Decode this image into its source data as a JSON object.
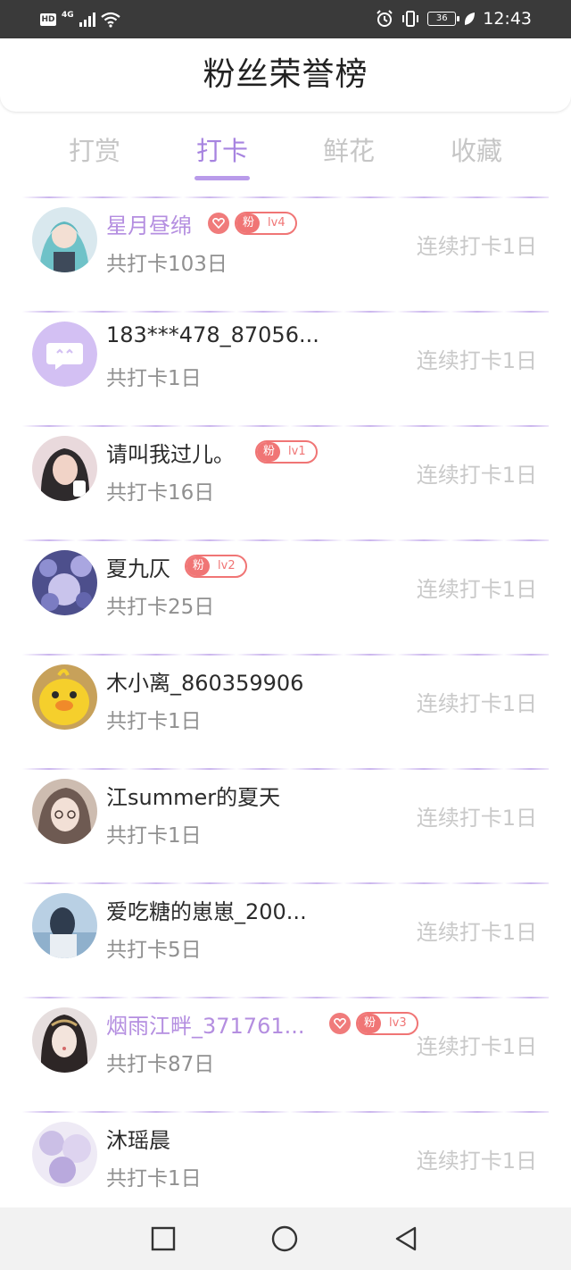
{
  "status_bar": {
    "left_icons": [
      "hd-icon",
      "4g-signal-icon",
      "wifi-icon"
    ],
    "hd_label": "HD",
    "network_label": "4G",
    "right_icons": [
      "alarm-icon",
      "vibrate-icon",
      "battery-icon",
      "leaf-icon"
    ],
    "battery": "36",
    "time": "12:43"
  },
  "header": {
    "title": "粉丝荣誉榜"
  },
  "tabs": [
    {
      "label": "打赏",
      "active": false
    },
    {
      "label": "打卡",
      "active": true
    },
    {
      "label": "鲜花",
      "active": false
    },
    {
      "label": "收藏",
      "active": false
    }
  ],
  "colors": {
    "accent": "#a784e0",
    "vip_name": "#b48ee0",
    "fan_badge": "#f07575",
    "muted": "#c9c9c9"
  },
  "list": [
    {
      "name": "星月昼绵",
      "total": "共打卡103日",
      "streak": "连续打卡1日",
      "vip": true,
      "heart": true,
      "fan_level": "lv4",
      "fan_label": "粉"
    },
    {
      "name": "183***478_87056...",
      "total": "共打卡1日",
      "streak": "连续打卡1日",
      "vip": false,
      "heart": false
    },
    {
      "name": "请叫我过儿。",
      "total": "共打卡16日",
      "streak": "连续打卡1日",
      "vip": false,
      "heart": false,
      "fan_level": "lv1",
      "fan_label": "粉"
    },
    {
      "name": "夏九仄",
      "total": "共打卡25日",
      "streak": "连续打卡1日",
      "vip": false,
      "heart": false,
      "fan_level": "lv2",
      "fan_label": "粉"
    },
    {
      "name": "木小离_860359906",
      "total": "共打卡1日",
      "streak": "连续打卡1日",
      "vip": false,
      "heart": false
    },
    {
      "name": "江summer的夏天",
      "total": "共打卡1日",
      "streak": "连续打卡1日",
      "vip": false,
      "heart": false
    },
    {
      "name": "爱吃糖的崽崽_200...",
      "total": "共打卡5日",
      "streak": "连续打卡1日",
      "vip": false,
      "heart": false
    },
    {
      "name": "烟雨江畔_371761...",
      "total": "共打卡87日",
      "streak": "连续打卡1日",
      "vip": true,
      "heart": true,
      "fan_level": "lv3",
      "fan_label": "粉"
    },
    {
      "name": "沐瑶晨",
      "total": "共打卡1日",
      "streak": "连续打卡1日",
      "vip": false,
      "heart": false
    }
  ],
  "navbar": {
    "buttons": [
      "recent-apps-icon",
      "home-icon",
      "back-icon"
    ]
  }
}
